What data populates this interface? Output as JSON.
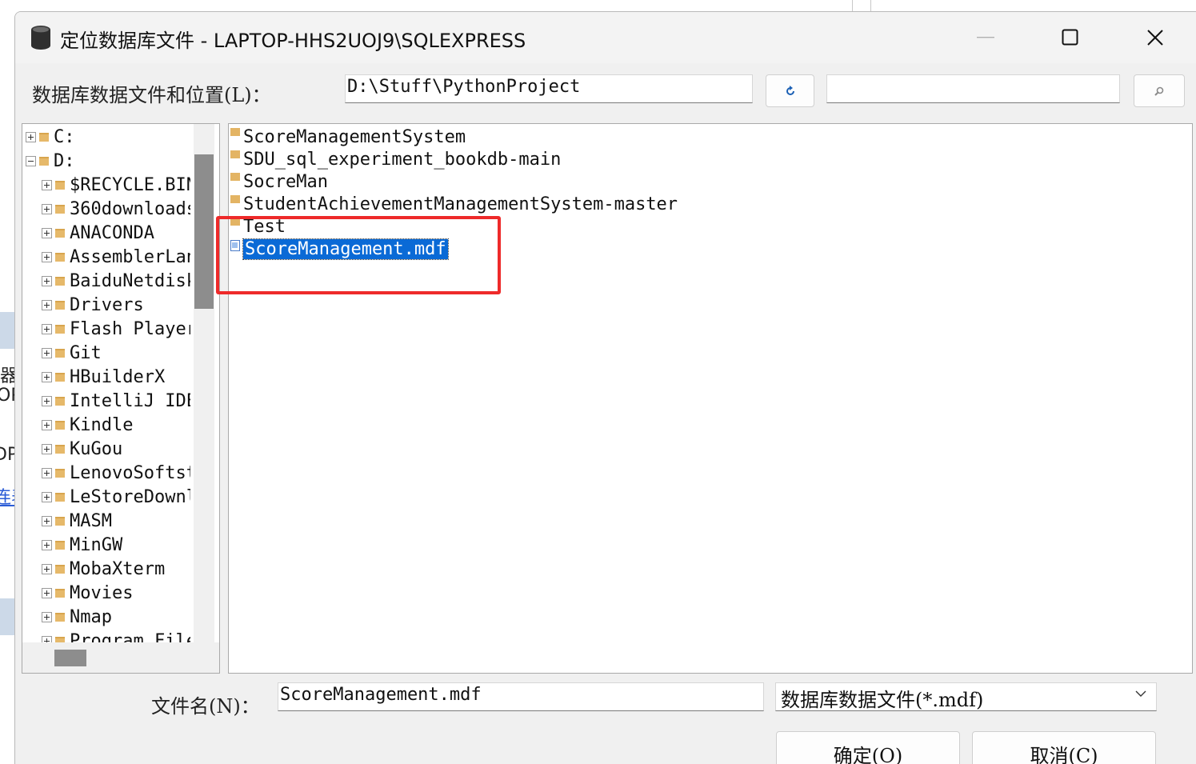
{
  "background": {
    "fragments": [
      "器",
      "OP",
      "DP",
      "连表"
    ]
  },
  "dialog": {
    "title": "定位数据库文件 - LAPTOP-HHS2UOJ9\\SQLEXPRESS",
    "location_label": "数据库数据文件和位置(L)：",
    "location_value": "D:\\Stuff\\PythonProject",
    "search_value": "",
    "filename_label": "文件名(N)：",
    "filename_value": "ScoreManagement.mdf",
    "filetype_value": "数据库数据文件(*.mdf)",
    "ok_label": "确定(O)",
    "cancel_label": "取消(C)"
  },
  "tree": {
    "drives": [
      {
        "label": "C:",
        "expanded": false
      },
      {
        "label": "D:",
        "expanded": true
      }
    ],
    "folders": [
      "$RECYCLE.BIN",
      "360downloads",
      "ANACONDA",
      "AssemblerLang",
      "BaiduNetdisk",
      "Drivers",
      "Flash Player",
      "Git",
      "HBuilderX",
      "IntelliJ IDEA",
      "Kindle",
      "KuGou",
      "LenovoSoftstore",
      "LeStoreDownload",
      "MASM",
      "MinGW",
      "MobaXterm",
      "Movies",
      "Nmap",
      "Program Files"
    ]
  },
  "files": [
    {
      "name": "ScoreManagementSystem",
      "type": "folder",
      "selected": false
    },
    {
      "name": "SDU_sql_experiment_bookdb-main",
      "type": "folder",
      "selected": false
    },
    {
      "name": "SocreMan",
      "type": "folder",
      "selected": false
    },
    {
      "name": "StudentAchievementManagementSystem-master",
      "type": "folder",
      "selected": false
    },
    {
      "name": "Test",
      "type": "folder",
      "selected": false
    },
    {
      "name": "ScoreManagement.mdf",
      "type": "file",
      "selected": true
    }
  ],
  "colors": {
    "selection": "#0a6ad6",
    "annotation": "#ee2a2a",
    "folder": "#e3b464"
  }
}
